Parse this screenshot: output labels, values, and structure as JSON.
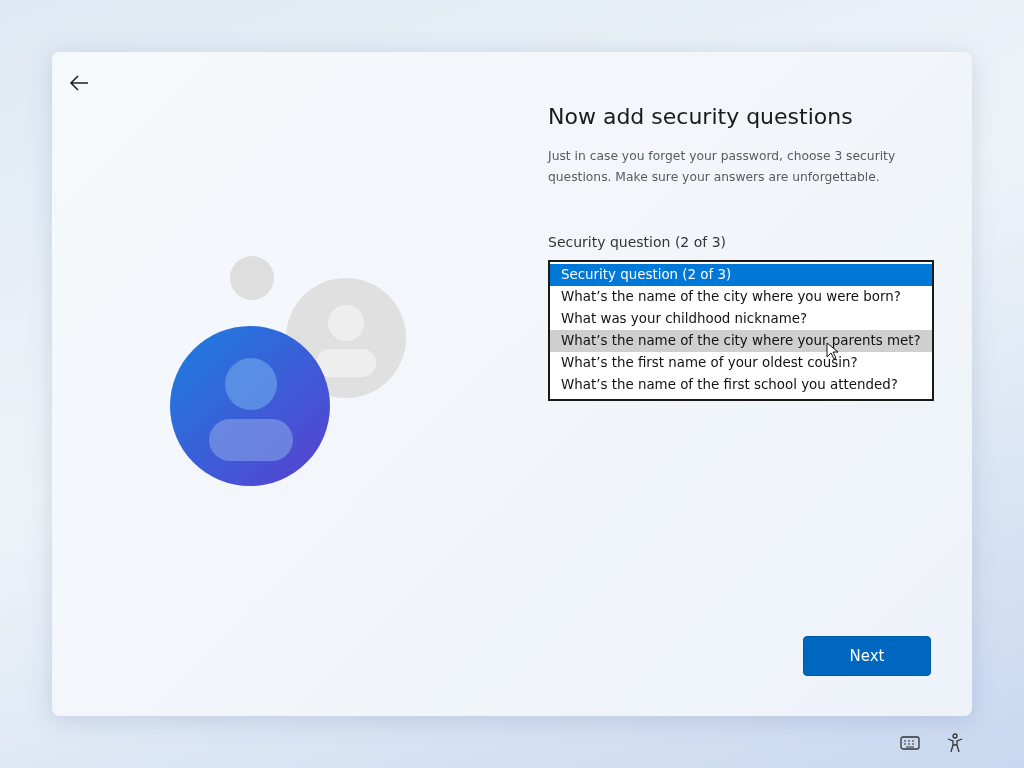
{
  "title": "Now add security questions",
  "description": "Just in case you forget your password, choose 3 security questions. Make sure your answers are unforgettable.",
  "field_label": "Security question (2 of 3)",
  "options": [
    {
      "label": "Security question (2 of 3)",
      "selected": true,
      "hovered": false
    },
    {
      "label": "What’s the name of the city where you were born?",
      "selected": false,
      "hovered": false
    },
    {
      "label": "What was your childhood nickname?",
      "selected": false,
      "hovered": false
    },
    {
      "label": "What’s the name of the city where your parents met?",
      "selected": false,
      "hovered": true
    },
    {
      "label": "What’s the first name of your oldest cousin?",
      "selected": false,
      "hovered": false
    },
    {
      "label": "What’s the name of the first school you attended?",
      "selected": false,
      "hovered": false
    }
  ],
  "next_button": "Next"
}
